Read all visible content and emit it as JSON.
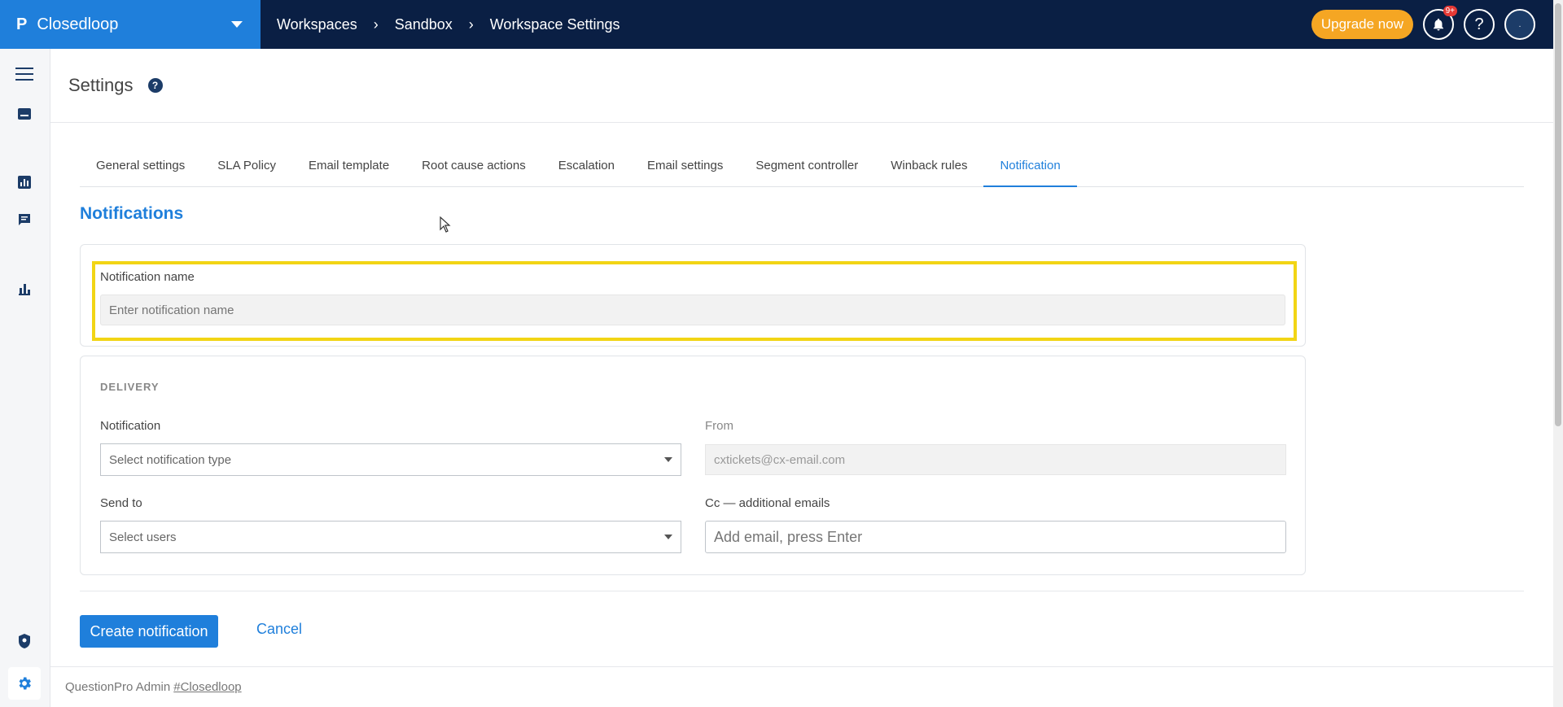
{
  "header": {
    "brand_logo": "P",
    "brand_name": "Closedloop",
    "breadcrumb": [
      "Workspaces",
      "Sandbox",
      "Workspace Settings"
    ],
    "upgrade_label": "Upgrade now",
    "notification_badge": "9+",
    "help_label": "?"
  },
  "page": {
    "title": "Settings",
    "help_label": "?"
  },
  "tabs": [
    {
      "label": "General settings"
    },
    {
      "label": "SLA Policy"
    },
    {
      "label": "Email template"
    },
    {
      "label": "Root cause actions"
    },
    {
      "label": "Escalation"
    },
    {
      "label": "Email settings"
    },
    {
      "label": "Segment controller"
    },
    {
      "label": "Winback rules"
    },
    {
      "label": "Notification",
      "active": true
    }
  ],
  "form": {
    "section_title": "Notifications",
    "name_label": "Notification name",
    "name_placeholder": "Enter notification name",
    "delivery_heading": "DELIVERY",
    "notification_label": "Notification",
    "notification_placeholder": "Select notification type",
    "from_label": "From",
    "from_value": "cxtickets@cx-email.com",
    "sendto_label": "Send to",
    "sendto_placeholder": "Select users",
    "cc_label": "Cc — additional emails",
    "cc_placeholder": "Add email, press Enter"
  },
  "actions": {
    "create_label": "Create notification",
    "cancel_label": "Cancel"
  },
  "footer": {
    "text": "QuestionPro Admin",
    "link": "#Closedloop"
  },
  "colors": {
    "topbar": "#0a1f44",
    "brand": "#1f7fdb",
    "accent": "#1f7fdb",
    "upgrade": "#f5a623",
    "highlight": "#f2d515"
  }
}
